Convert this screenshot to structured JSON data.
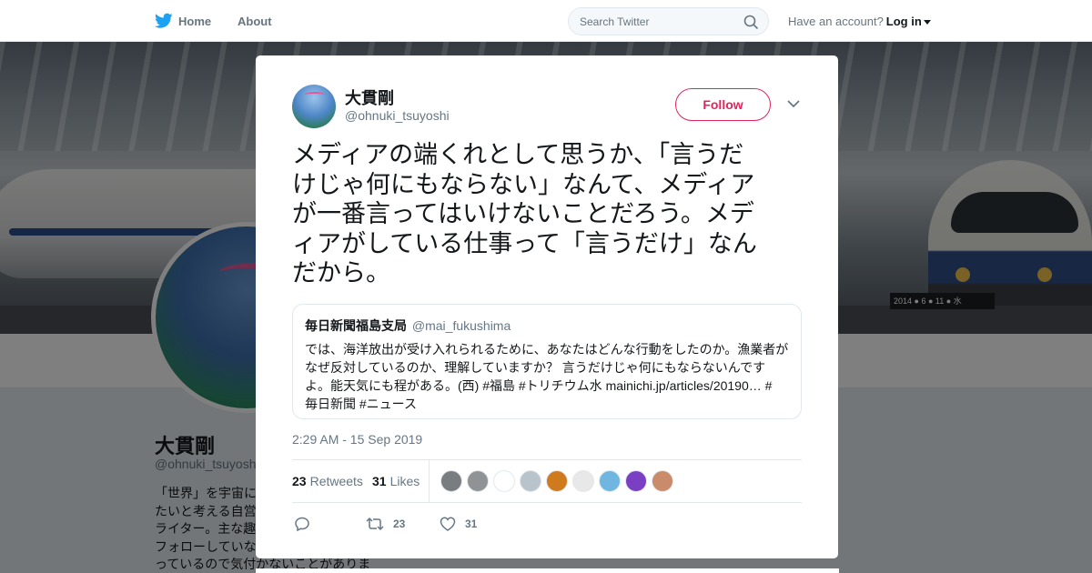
{
  "nav": {
    "home_label": "Home",
    "about_label": "About",
    "search_placeholder": "Search Twitter",
    "have_account": "Have an account?",
    "login_label": "Log in"
  },
  "banner": {
    "sign_text": "2014 ● 6 ● 11 ● 水"
  },
  "profile": {
    "name": "大貫剛",
    "handle": "@ohnuki_tsuyoshi",
    "bio_lines": [
      "「世界」を宇宙に",
      "たいと考える自営",
      "ライター。主な趣",
      "フォローしていな",
      "っているので気付かないことがありま"
    ]
  },
  "tweet": {
    "author_name": "大貫剛",
    "author_handle": "@ohnuki_tsuyoshi",
    "follow_label": "Follow",
    "text_lines": [
      "メディアの端くれとして思うか、「言うだ",
      "けじゃ何にもならない」なんて、メディア",
      "が一番言ってはいけないことだろう。メデ",
      "ィアがしている仕事って「言うだけ」なん",
      "だから。"
    ],
    "quote": {
      "name": "毎日新聞福島支局",
      "handle": "@mai_fukushima",
      "body_lines": [
        "では、海洋放出が受け入れられるために、あなたはどんな行動をしたのか。漁業者が",
        "なぜ反対しているのか、理解していますか？ 言うだけじゃ何にもならないんです",
        "よ。能天気にも程がある。(西) #福島  #トリチウム水  mainichi.jp/articles/20190… #",
        "毎日新聞 #ニュース"
      ]
    },
    "timestamp": "2:29 AM - 15 Sep 2019",
    "retweets_count": "23",
    "retweets_label": "Retweets",
    "likes_count": "31",
    "likes_label": "Likes",
    "action_retweet_count": "23",
    "action_like_count": "31",
    "liker_colors": [
      "#7a7d80",
      "#8f9396",
      "#ffffff",
      "#b9c3cc",
      "#d07a1e",
      "#e8e8e8",
      "#6fb6e0",
      "#7b3fc4",
      "#c98b6a"
    ]
  },
  "colors": {
    "accent": "#e0245e",
    "twitter_blue": "#1da1f2"
  }
}
